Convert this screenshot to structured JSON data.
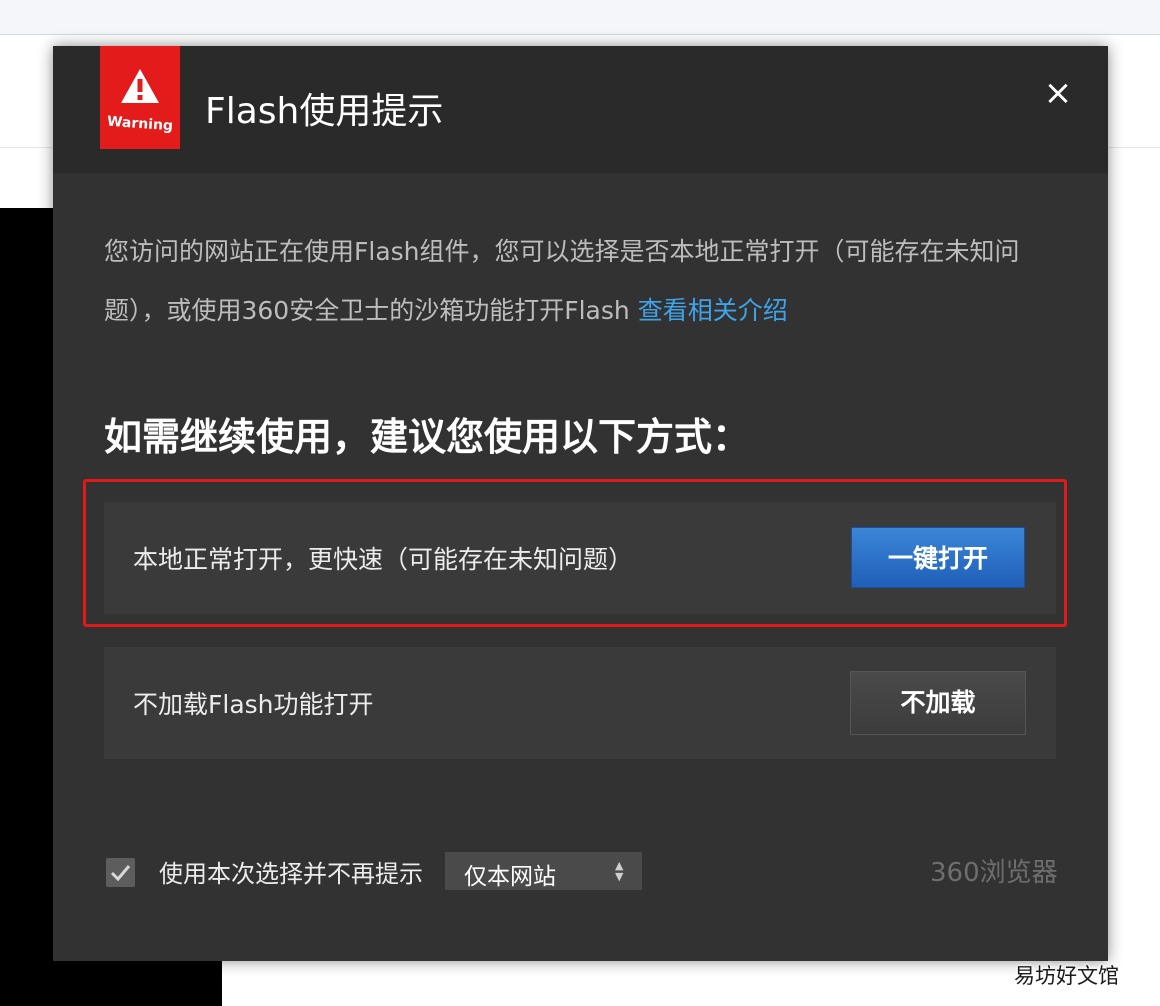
{
  "dialog": {
    "warning_badge": "Warning",
    "title": "Flash使用提示",
    "close_glyph": "×",
    "description": "您访问的网站正在使用Flash组件，您可以选择是否本地正常打开（可能存在未知问题），或使用360安全卫士的沙箱功能打开Flash",
    "description_link": "查看相关介绍",
    "heading": "如需继续使用，建议您使用以下方式：",
    "options": [
      {
        "label": "本地正常打开，更快速（可能存在未知问题）",
        "button": "一键打开"
      },
      {
        "label": "不加载Flash功能打开",
        "button": "不加载"
      }
    ],
    "footer": {
      "checkbox_checked": true,
      "checkbox_label": "使用本次选择并不再提示",
      "scope_selected": "仅本网站",
      "brand": "360浏览器"
    }
  },
  "icons": {
    "warning": "warning-triangle-icon",
    "close": "close-icon",
    "check": "checkmark-icon",
    "select_arrows": "updown-arrows-icon"
  },
  "colors": {
    "warning_red": "#e31b1b",
    "highlight_border": "#e11919",
    "link": "#3fa3ea",
    "primary_button": "#2a70c8"
  },
  "watermark": "易坊好文馆"
}
